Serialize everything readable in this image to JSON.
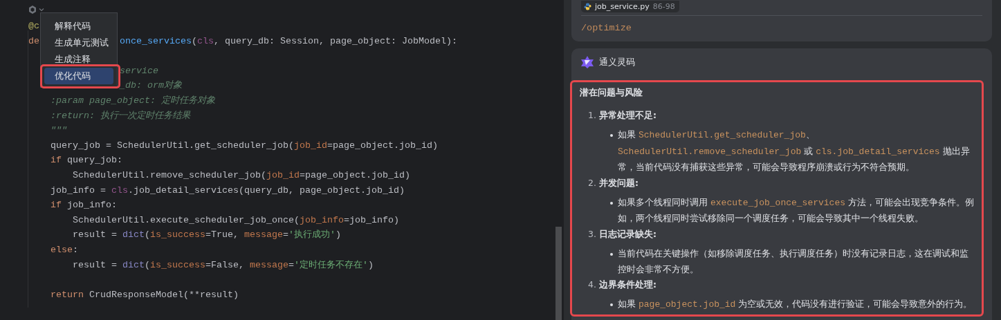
{
  "editor": {
    "code_lines": [
      {
        "kind": "code",
        "head": [
          {
            "text": "@c",
            "kind": "decorator"
          }
        ]
      },
      {
        "kind": "code",
        "head": [
          {
            "text": "de",
            "kind": "keyword"
          }
        ],
        "tail": [
          {
            "text": "once_services",
            "kind": "function"
          },
          {
            "text": "(",
            "kind": "plain"
          },
          {
            "text": "cls",
            "kind": "self"
          },
          {
            "text": ", query_db: Session, page_object: JobModel):",
            "kind": "plain"
          }
        ]
      },
      {
        "kind": "blank"
      },
      {
        "kind": "code",
        "tail": [
          {
            "text": "service",
            "kind": "comment"
          }
        ]
      },
      {
        "kind": "code",
        "tail": [
          {
            "text": "_db: orm对象",
            "kind": "comment"
          }
        ]
      },
      {
        "kind": "code",
        "head": [
          {
            "text": "    :param page_object: 定时任务对象",
            "kind": "comment"
          }
        ]
      },
      {
        "kind": "code",
        "head": [
          {
            "text": "    :return: 执行一次定时任务结果",
            "kind": "comment"
          }
        ]
      },
      {
        "kind": "code",
        "head": [
          {
            "text": "    \"\"\"",
            "kind": "comment"
          }
        ]
      },
      {
        "kind": "code",
        "head": [
          {
            "text": "    query_job = SchedulerUtil.get_scheduler_job(",
            "kind": "plain"
          },
          {
            "text": "job_id",
            "kind": "param"
          },
          {
            "text": "=page_object.job_id)",
            "kind": "plain"
          }
        ]
      },
      {
        "kind": "code",
        "head": [
          {
            "text": "    if",
            "kind": "keyword"
          },
          {
            "text": " query_job:",
            "kind": "plain"
          }
        ]
      },
      {
        "kind": "code",
        "head": [
          {
            "text": "        SchedulerUtil.remove_scheduler_job(",
            "kind": "plain"
          },
          {
            "text": "job_id",
            "kind": "param"
          },
          {
            "text": "=page_object.job_id)",
            "kind": "plain"
          }
        ]
      },
      {
        "kind": "code",
        "head": [
          {
            "text": "    job_info = ",
            "kind": "plain"
          },
          {
            "text": "cls",
            "kind": "self"
          },
          {
            "text": ".job_detail_services(query_db, page_object.job_id)",
            "kind": "plain"
          }
        ]
      },
      {
        "kind": "code",
        "head": [
          {
            "text": "    if",
            "kind": "keyword"
          },
          {
            "text": " job_info:",
            "kind": "plain"
          }
        ]
      },
      {
        "kind": "code",
        "head": [
          {
            "text": "        SchedulerUtil.execute_scheduler_job_once(",
            "kind": "plain"
          },
          {
            "text": "job_info",
            "kind": "param"
          },
          {
            "text": "=job_info)",
            "kind": "plain"
          }
        ]
      },
      {
        "kind": "code",
        "head": [
          {
            "text": "        result = ",
            "kind": "plain"
          },
          {
            "text": "dict",
            "kind": "builtin"
          },
          {
            "text": "(",
            "kind": "plain"
          },
          {
            "text": "is_success",
            "kind": "param"
          },
          {
            "text": "=True, ",
            "kind": "plain"
          },
          {
            "text": "message",
            "kind": "param"
          },
          {
            "text": "=",
            "kind": "plain"
          },
          {
            "text": "'执行成功'",
            "kind": "string"
          },
          {
            "text": ")",
            "kind": "plain"
          }
        ]
      },
      {
        "kind": "code",
        "head": [
          {
            "text": "    else",
            "kind": "keyword"
          },
          {
            "text": ":",
            "kind": "plain"
          }
        ]
      },
      {
        "kind": "code",
        "head": [
          {
            "text": "        result = ",
            "kind": "plain"
          },
          {
            "text": "dict",
            "kind": "builtin"
          },
          {
            "text": "(",
            "kind": "plain"
          },
          {
            "text": "is_success",
            "kind": "param"
          },
          {
            "text": "=False, ",
            "kind": "plain"
          },
          {
            "text": "message",
            "kind": "param"
          },
          {
            "text": "=",
            "kind": "plain"
          },
          {
            "text": "'定时任务不存在'",
            "kind": "string"
          },
          {
            "text": ")",
            "kind": "plain"
          }
        ]
      },
      {
        "kind": "blank"
      },
      {
        "kind": "code",
        "head": [
          {
            "text": "    return",
            "kind": "keyword"
          },
          {
            "text": " CrudResponseModel(**result)",
            "kind": "plain"
          }
        ]
      }
    ],
    "context_menu": {
      "items": [
        {
          "label": "解释代码",
          "selected": false,
          "annotated": false
        },
        {
          "label": "生成单元测试",
          "selected": false,
          "annotated": false
        },
        {
          "label": "生成注释",
          "selected": false,
          "annotated": false
        },
        {
          "label": "优化代码",
          "selected": true,
          "annotated": true
        }
      ]
    }
  },
  "chat": {
    "request": {
      "file_name": "job_service.py",
      "line_range": "86-98",
      "command": "/optimize"
    },
    "reply": {
      "assistant": "通义灵码",
      "annotated": true,
      "heading": "潜在问题与风险",
      "sections": [
        {
          "number": "1.",
          "title": "异常处理不足:",
          "bullets": [
            [
              {
                "text": "如果 ",
                "kind": "text"
              },
              {
                "text": "SchedulerUtil.get_scheduler_job",
                "kind": "code"
              },
              {
                "text": "、",
                "kind": "text"
              },
              {
                "text": "SchedulerUtil.remove_scheduler_job",
                "kind": "code"
              },
              {
                "text": " 或 ",
                "kind": "text"
              },
              {
                "text": "cls.job_detail_services",
                "kind": "code"
              },
              {
                "text": " 抛出异常，当前代码没有捕获这些异常，可能会导致程序崩溃或行为不符合预期。",
                "kind": "text"
              }
            ]
          ]
        },
        {
          "number": "2.",
          "title": "并发问题:",
          "bullets": [
            [
              {
                "text": "如果多个线程同时调用 ",
                "kind": "text"
              },
              {
                "text": "execute_job_once_services",
                "kind": "code"
              },
              {
                "text": " 方法，可能会出现竞争条件。例如，两个线程同时尝试移除同一个调度任务，可能会导致其中一个线程失败。",
                "kind": "text"
              }
            ]
          ]
        },
        {
          "number": "3.",
          "title": "日志记录缺失:",
          "bullets": [
            [
              {
                "text": "当前代码在关键操作（如移除调度任务、执行调度任务）时没有记录日志，这在调试和监控时会非常不方便。",
                "kind": "text"
              }
            ]
          ]
        },
        {
          "number": "4.",
          "title": "边界条件处理:",
          "bullets": [
            [
              {
                "text": "如果 ",
                "kind": "text"
              },
              {
                "text": "page_object.job_id",
                "kind": "code"
              },
              {
                "text": " 为空或无效，代码没有进行验证，可能会导致意外的行为。",
                "kind": "text"
              }
            ]
          ]
        }
      ]
    }
  }
}
